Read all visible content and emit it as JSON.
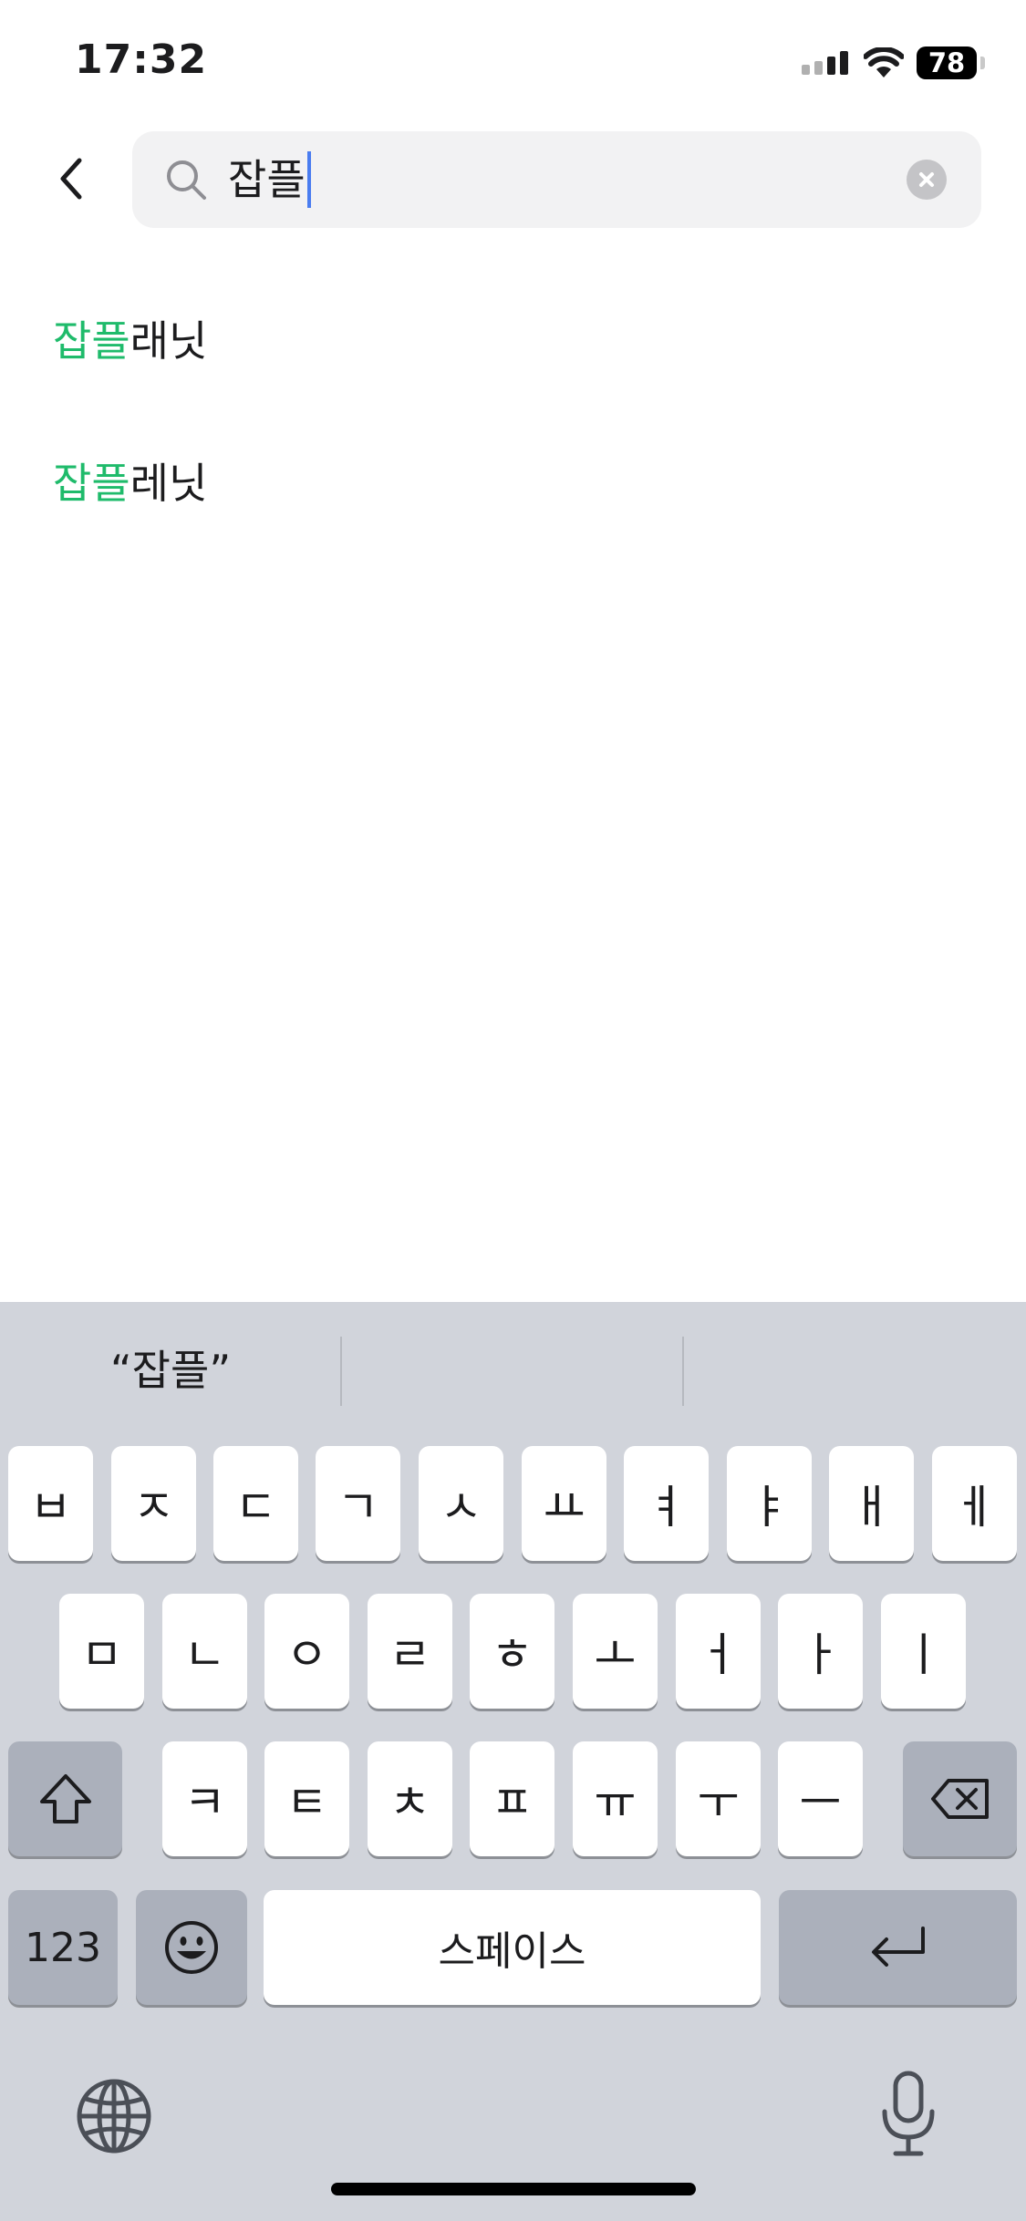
{
  "status_bar": {
    "time": "17:32",
    "battery": "78",
    "icons": [
      "signal-icon",
      "wifi-icon",
      "battery-icon"
    ]
  },
  "header": {
    "back_icon": "chevron-left-icon",
    "search": {
      "value": "잡플",
      "icon": "search-icon",
      "clear_icon": "clear-circle-icon"
    }
  },
  "suggestions": [
    {
      "highlight": "잡플",
      "rest": "래닛"
    },
    {
      "highlight": "잡플",
      "rest": "레닛"
    }
  ],
  "keyboard": {
    "predictions": [
      "“잡플”",
      "",
      ""
    ],
    "row1": [
      "ㅂ",
      "ㅈ",
      "ㄷ",
      "ㄱ",
      "ㅅ",
      "ㅛ",
      "ㅕ",
      "ㅑ",
      "ㅐ",
      "ㅔ"
    ],
    "row2": [
      "ㅁ",
      "ㄴ",
      "ㅇ",
      "ㄹ",
      "ㅎ",
      "ㅗ",
      "ㅓ",
      "ㅏ",
      "ㅣ"
    ],
    "row3": [
      "ㅋ",
      "ㅌ",
      "ㅊ",
      "ㅍ",
      "ㅠ",
      "ㅜ",
      "ㅡ"
    ],
    "numbers_key": "123",
    "space_key": "스페이스",
    "shift_icon": "shift-icon",
    "delete_icon": "backspace-icon",
    "emoji_icon": "emoji-icon",
    "return_icon": "return-icon",
    "globe_icon": "globe-icon",
    "mic_icon": "microphone-icon"
  },
  "colors": {
    "highlight": "#1fbb6b",
    "caret": "#4a7df0",
    "keyboard_bg": "#d1d4db"
  }
}
